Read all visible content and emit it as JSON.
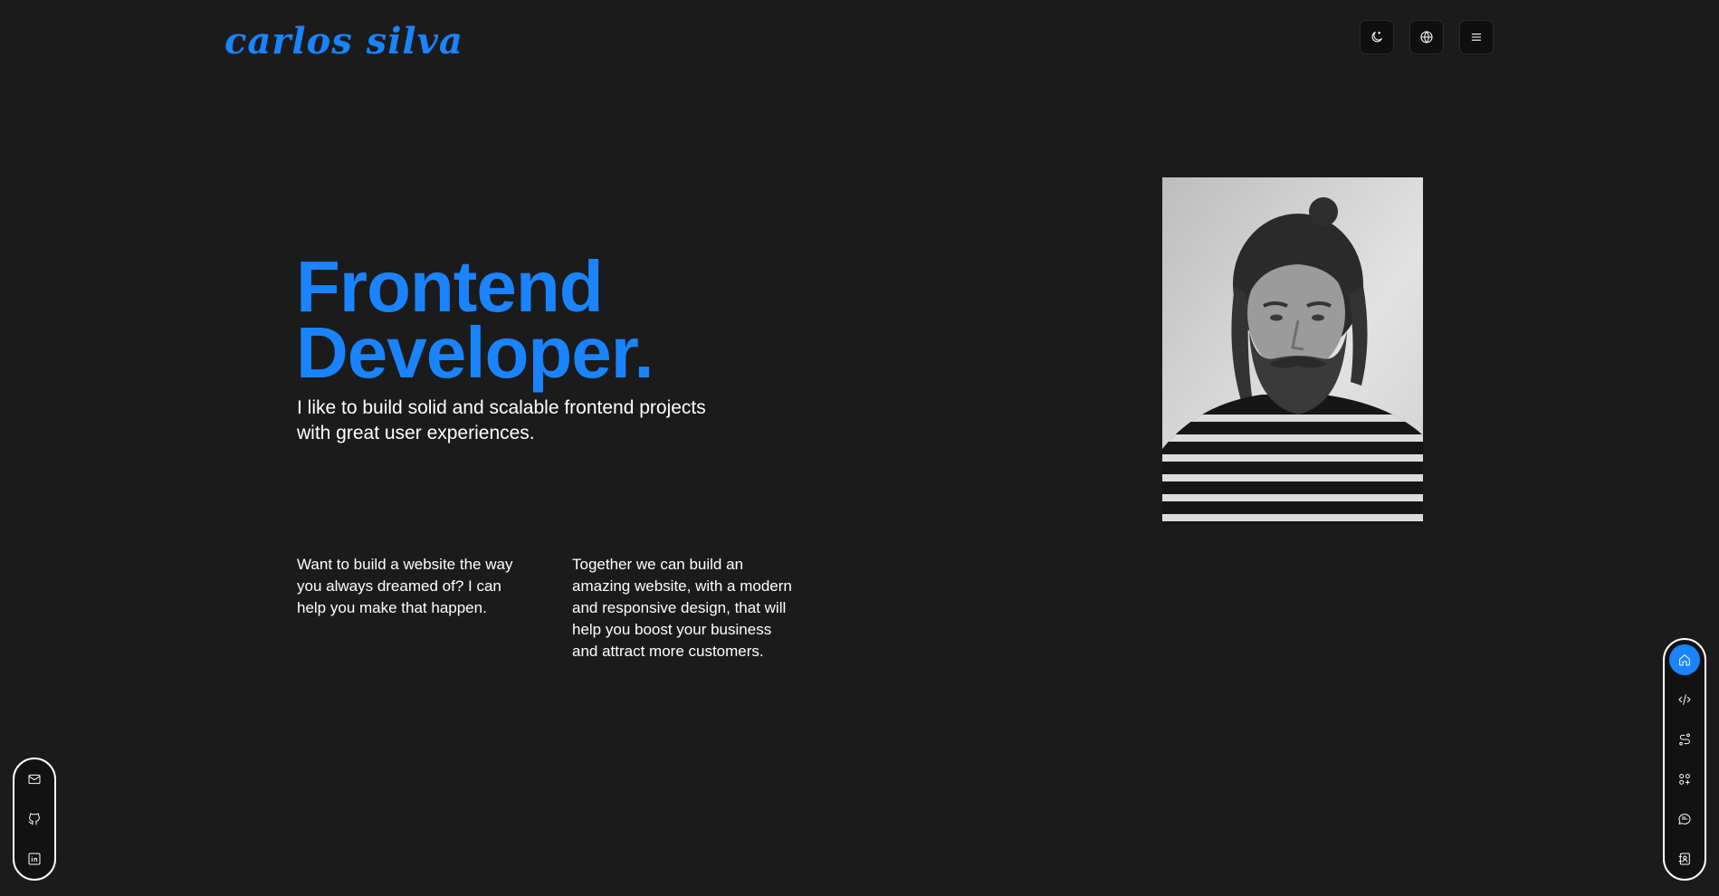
{
  "header": {
    "logo_text": "carlos silva",
    "actions": [
      {
        "icon": "moon-icon"
      },
      {
        "icon": "globe-icon"
      },
      {
        "icon": "menu-icon"
      }
    ]
  },
  "hero": {
    "title_line1": "Frontend",
    "title_line2": "Developer.",
    "subtitle": "I like to build solid and scalable frontend projects with great user experiences.",
    "pitch_1": "Want to build a website the way you always dreamed of? I can help you make that happen.",
    "pitch_2": "Together we can build an amazing website, with a modern and responsive design, that will help you boost your business and attract more customers."
  },
  "social": [
    {
      "icon": "mail-icon"
    },
    {
      "icon": "github-icon"
    },
    {
      "icon": "linkedin-icon"
    }
  ],
  "nav": [
    {
      "icon": "home-icon",
      "active": true
    },
    {
      "icon": "code-icon",
      "active": false
    },
    {
      "icon": "route-icon",
      "active": false
    },
    {
      "icon": "apps-add-icon",
      "active": false
    },
    {
      "icon": "message-icon",
      "active": false
    },
    {
      "icon": "contact-book-icon",
      "active": false
    }
  ],
  "colors": {
    "background": "#1b1b1b",
    "accent": "#1a83ff",
    "text": "#ffffff"
  }
}
